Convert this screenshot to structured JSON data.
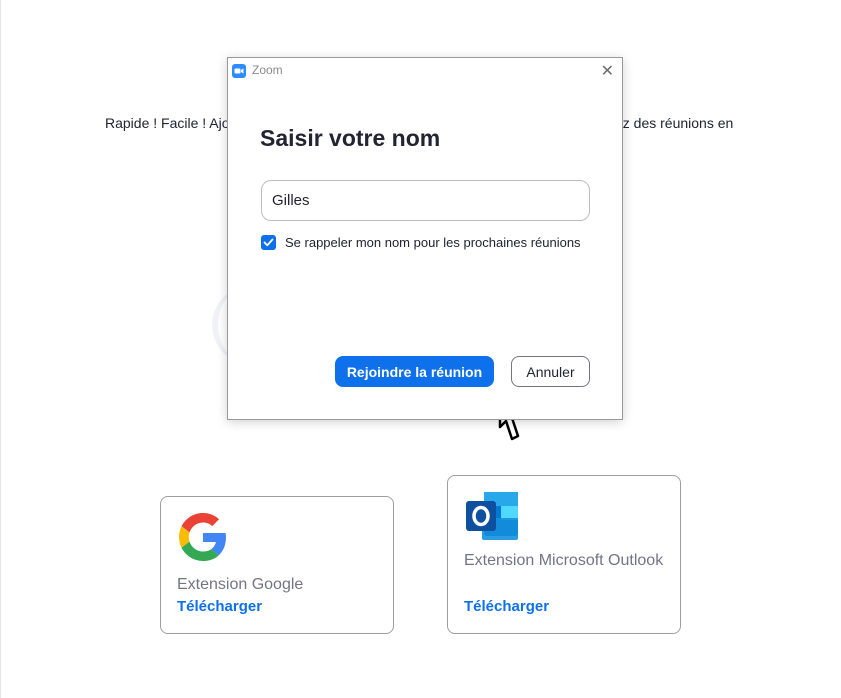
{
  "background": {
    "intro_text_left": "Rapide ! Facile ! Ajou",
    "intro_text_right": "ez des réunions en"
  },
  "extensions": [
    {
      "title": "Extension Google",
      "download_label": "Télécharger",
      "icon": "google-g-icon"
    },
    {
      "title": "Extension Microsoft Outlook",
      "download_label": "Télécharger",
      "icon": "outlook-icon"
    }
  ],
  "dialog": {
    "app_title": "Zoom",
    "heading": "Saisir votre nom",
    "name_value": "Gilles",
    "remember_checked": true,
    "remember_label": "Se rappeler mon nom pour les prochaines réunions",
    "join_label": "Rejoindre la réunion",
    "cancel_label": "Annuler"
  },
  "colors": {
    "accent": "#0e71eb",
    "zoom_blue": "#2d8cff"
  }
}
